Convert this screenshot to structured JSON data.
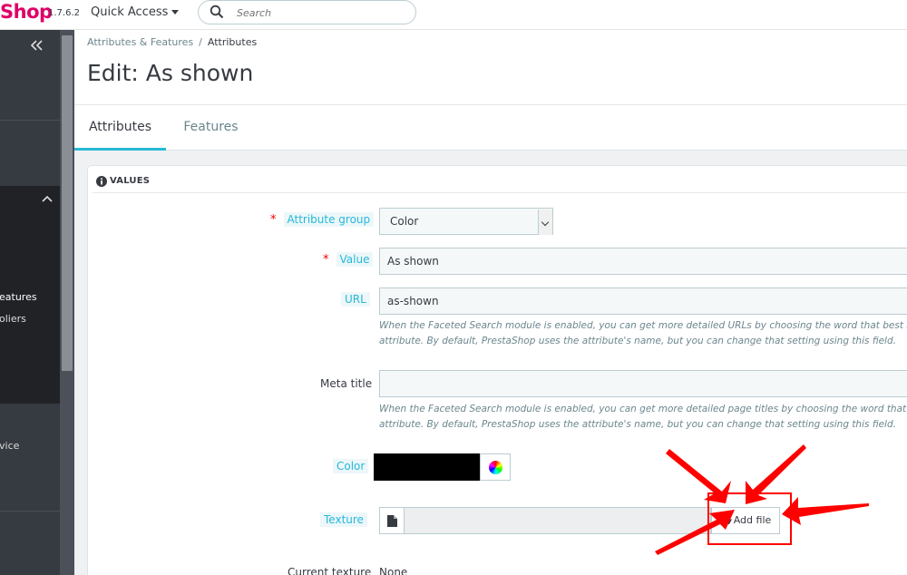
{
  "header": {
    "logo": "Shop",
    "version": "1.7.6.2",
    "quick_access": "Quick Access",
    "search_placeholder": "Search"
  },
  "sidebar": {
    "items": [
      {
        "label": "eatures",
        "active": true
      },
      {
        "label": "oliers",
        "active": false
      },
      {
        "label": "vice",
        "active": false
      }
    ]
  },
  "breadcrumb": {
    "parent": "Attributes & Features",
    "separator": "/",
    "current": "Attributes"
  },
  "page_title": "Edit: As shown",
  "tabs": [
    {
      "label": "Attributes",
      "active": true
    },
    {
      "label": "Features",
      "active": false
    }
  ],
  "panel": {
    "heading": "VALUES"
  },
  "form": {
    "attribute_group": {
      "label": "Attribute group",
      "value": "Color",
      "required": true
    },
    "value": {
      "label": "Value",
      "value": "As shown",
      "required": true
    },
    "url": {
      "label": "URL",
      "value": "as-shown",
      "help_line1": "When the Faceted Search module is enabled, you can get more detailed URLs by choosing the word that best repres",
      "help_line2": "attribute. By default, PrestaShop uses the attribute's name, but you can change that setting using this field."
    },
    "meta_title": {
      "label": "Meta title",
      "value": "",
      "help_line1": "When the Faceted Search module is enabled, you can get more detailed page titles by choosing the word that best r",
      "help_line2": "attribute. By default, PrestaShop uses the attribute's name, but you can change that setting using this field."
    },
    "color": {
      "label": "Color",
      "value": "#000000"
    },
    "texture": {
      "label": "Texture",
      "button": "Add file"
    },
    "current_texture": {
      "label": "Current texture",
      "value": "None"
    }
  },
  "colors": {
    "brand": "#df0067",
    "accent": "#25b9d7",
    "sidebar": "#363a41",
    "annotation": "#ff0000"
  }
}
